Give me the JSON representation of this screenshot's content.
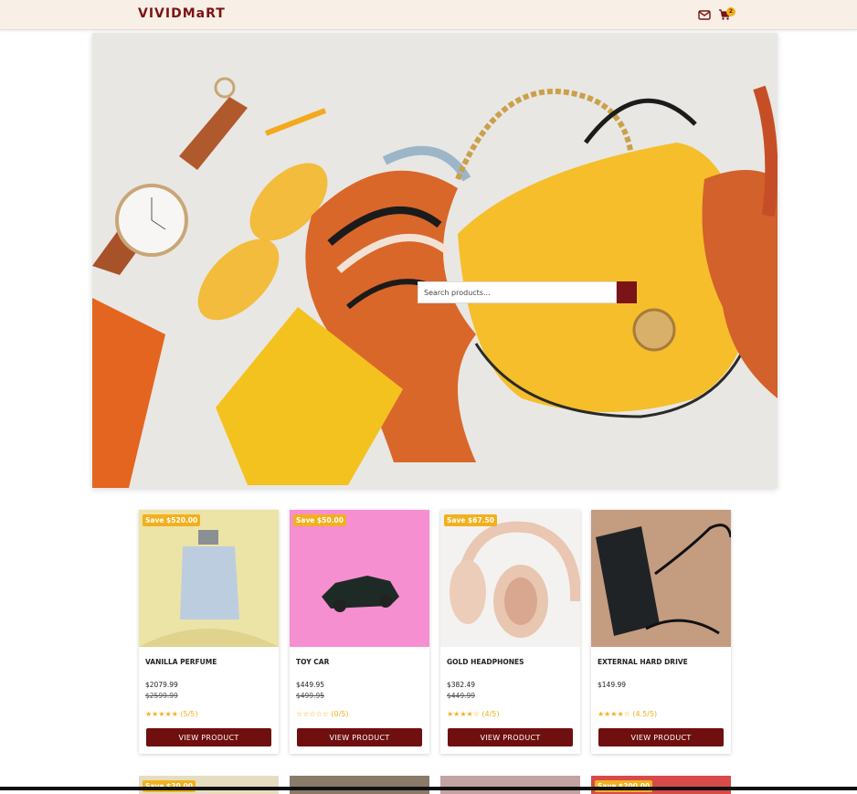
{
  "header": {
    "logo": "VIVIDMaRT",
    "cart_count": "2"
  },
  "icons": {
    "mail": "mail-icon",
    "cart": "cart-icon",
    "search": "search-icon"
  },
  "search": {
    "placeholder": "Search products..."
  },
  "products": [
    {
      "badge": "Save $520.00",
      "name": "VANILLA PERFUME",
      "price": "$2079.99",
      "old_price": "$2599.99",
      "rating": "★★★★★ (5/5)",
      "button": "VIEW PRODUCT"
    },
    {
      "badge": "Save $50.00",
      "name": "TOY CAR",
      "price": "$449.95",
      "old_price": "$499.95",
      "rating": "☆☆☆☆☆ (0/5)",
      "button": "VIEW PRODUCT"
    },
    {
      "badge": "Save $67.50",
      "name": "GOLD HEADPHONES",
      "price": "$382.49",
      "old_price": "$449.99",
      "rating": "★★★★☆ (4/5)",
      "button": "VIEW PRODUCT"
    },
    {
      "badge": "",
      "name": "EXTERNAL HARD DRIVE",
      "price": "$149.99",
      "old_price": "",
      "rating": "★★★★☆ (4.5/5)",
      "button": "VIEW PRODUCT"
    }
  ],
  "products_row2": [
    {
      "badge": "Save $20.00"
    },
    {
      "badge": ""
    },
    {
      "badge": ""
    },
    {
      "badge": "Save $200.00"
    }
  ],
  "colors": {
    "brand": "#7a1416",
    "accent": "#f2b01e",
    "header_bg": "#f8efe7"
  }
}
